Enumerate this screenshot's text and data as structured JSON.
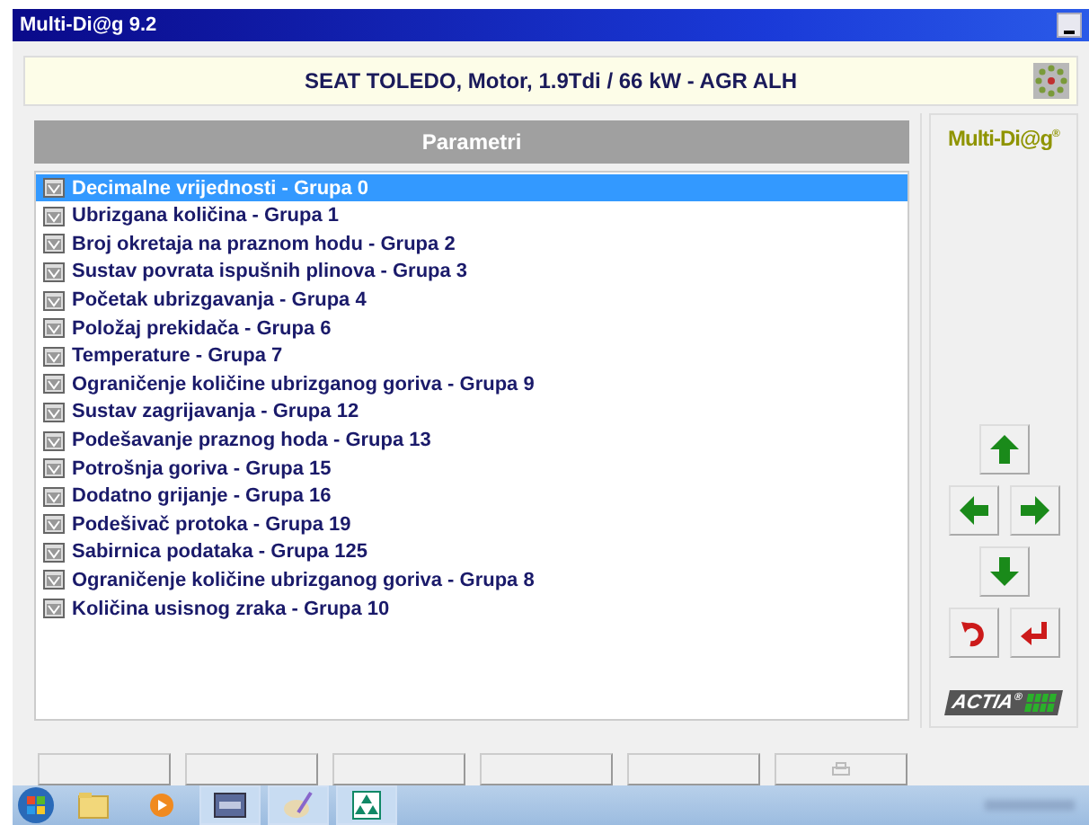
{
  "window": {
    "title": "Multi-Di@g 9.2"
  },
  "vehicle": "SEAT TOLEDO, Motor, 1.9Tdi / 66 kW - AGR ALH",
  "panel": {
    "title": "Parametri"
  },
  "items": [
    {
      "label": "Decimalne vrijednosti - Grupa 0",
      "selected": true
    },
    {
      "label": "Ubrizgana količina - Grupa 1",
      "selected": false
    },
    {
      "label": "Broj okretaja na praznom hodu - Grupa 2",
      "selected": false
    },
    {
      "label": "Sustav povrata ispušnih plinova - Grupa 3",
      "selected": false
    },
    {
      "label": "Početak ubrizgavanja - Grupa 4",
      "selected": false
    },
    {
      "label": "Položaj prekidača - Grupa 6",
      "selected": false
    },
    {
      "label": "Temperature - Grupa 7",
      "selected": false
    },
    {
      "label": "Ograničenje količine ubrizganog goriva - Grupa 9",
      "selected": false
    },
    {
      "label": "Sustav zagrijavanja - Grupa 12",
      "selected": false
    },
    {
      "label": "Podešavanje praznog hoda - Grupa 13",
      "selected": false
    },
    {
      "label": "Potrošnja goriva - Grupa 15",
      "selected": false
    },
    {
      "label": "Dodatno grijanje - Grupa 16",
      "selected": false
    },
    {
      "label": "Podešivač protoka - Grupa 19",
      "selected": false
    },
    {
      "label": "Sabirnica podataka - Grupa 125",
      "selected": false
    },
    {
      "label": "Ograničenje količine ubrizganog goriva - Grupa 8",
      "selected": false
    },
    {
      "label": "Količina usisnog zraka - Grupa 10",
      "selected": false
    }
  ],
  "brand": {
    "logo": "Multi-Di@g",
    "logo_mark": "®",
    "maker": "ACTIA",
    "maker_mark": "®"
  },
  "function_keys": [
    {
      "kind": "blank"
    },
    {
      "kind": "blank"
    },
    {
      "kind": "blank"
    },
    {
      "kind": "blank"
    },
    {
      "kind": "blank"
    },
    {
      "kind": "print"
    }
  ],
  "taskbar": [
    {
      "kind": "folder",
      "active": false
    },
    {
      "kind": "media",
      "active": false
    },
    {
      "kind": "window",
      "active": true
    },
    {
      "kind": "paint",
      "active": true
    },
    {
      "kind": "app",
      "active": true
    }
  ]
}
